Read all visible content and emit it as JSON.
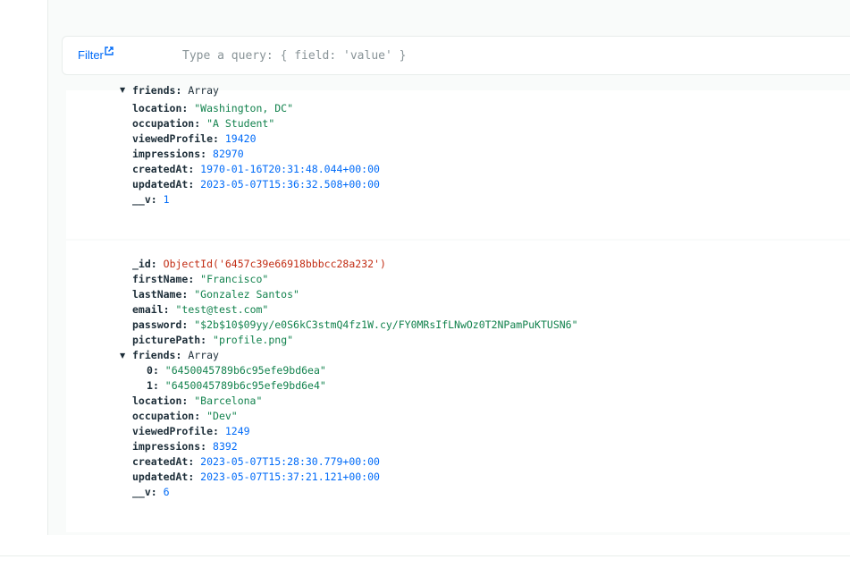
{
  "filter": {
    "label": "Filter",
    "placeholder": "Type a query: { field: 'value' }"
  },
  "doc1": {
    "friends_key": "friends",
    "friends_type": "Array",
    "location_key": "location",
    "location": "\"Washington, DC\"",
    "occupation_key": "occupation",
    "occupation": "\"A Student\"",
    "viewedProfile_key": "viewedProfile",
    "viewedProfile": "19420",
    "impressions_key": "impressions",
    "impressions": "82970",
    "createdAt_key": "createdAt",
    "createdAt": "1970-01-16T20:31:48.044+00:00",
    "updatedAt_key": "updatedAt",
    "updatedAt": "2023-05-07T15:36:32.508+00:00",
    "v_key": "__v",
    "v": "1"
  },
  "doc2": {
    "id_key": "_id",
    "id": "ObjectId('6457c39e66918bbbcc28a232')",
    "firstName_key": "firstName",
    "firstName": "\"Francisco\"",
    "lastName_key": "lastName",
    "lastName": "\"Gonzalez Santos\"",
    "email_key": "email",
    "email": "\"test@test.com\"",
    "password_key": "password",
    "password": "\"$2b$10$09yy/e0S6kC3stmQ4fz1W.cy/FY0MRsIfLNwOz0T2NPamPuKTUSN6\"",
    "picturePath_key": "picturePath",
    "picturePath": "\"profile.png\"",
    "friends_key": "friends",
    "friends_type": "Array",
    "friends": [
      {
        "index": "0",
        "value": "\"6450045789b6c95efe9bd6ea\""
      },
      {
        "index": "1",
        "value": "\"6450045789b6c95efe9bd6e4\""
      }
    ],
    "location_key": "location",
    "location": "\"Barcelona\"",
    "occupation_key": "occupation",
    "occupation": "\"Dev\"",
    "viewedProfile_key": "viewedProfile",
    "viewedProfile": "1249",
    "impressions_key": "impressions",
    "impressions": "8392",
    "createdAt_key": "createdAt",
    "createdAt": "2023-05-07T15:28:30.779+00:00",
    "updatedAt_key": "updatedAt",
    "updatedAt": "2023-05-07T15:37:21.121+00:00",
    "v_key": "__v",
    "v": "6"
  },
  "colors": {
    "key": "#1c2d38",
    "string": "#12824d",
    "number": "#016bf8",
    "objectid": "#c22d14",
    "link": "#016bf8"
  }
}
